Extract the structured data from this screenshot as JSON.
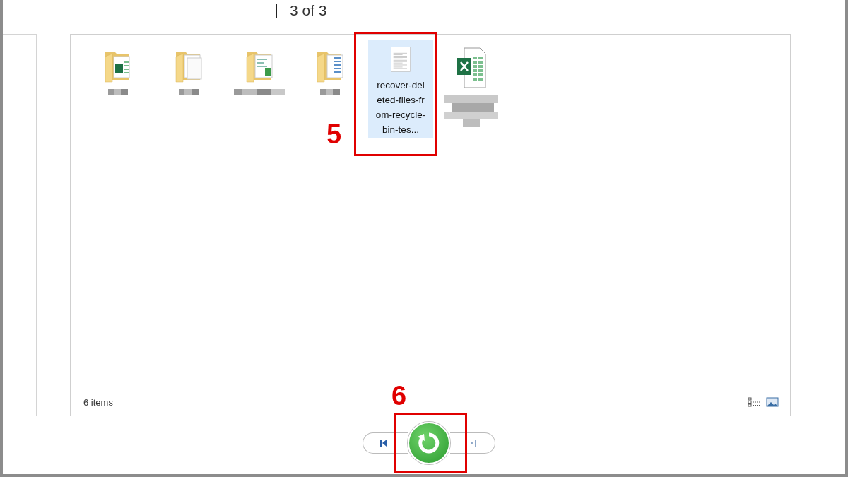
{
  "header": {
    "page_indicator": "3 of 3"
  },
  "files": [
    {
      "kind": "folder-sheet",
      "selected": false
    },
    {
      "kind": "folder-blank",
      "selected": false
    },
    {
      "kind": "folder-chart",
      "selected": false
    },
    {
      "kind": "folder-list",
      "selected": false
    },
    {
      "kind": "document",
      "name": "recover-deleted-files-from-recycle-bin-tes...",
      "selected": true
    },
    {
      "kind": "spreadsheet",
      "selected": false
    }
  ],
  "status_bar": {
    "count": "6 items"
  },
  "annotations": [
    {
      "label": "5"
    },
    {
      "label": "6"
    }
  ],
  "navigation": [
    {
      "kind": "first"
    },
    {
      "kind": "recover"
    },
    {
      "kind": "last"
    }
  ]
}
